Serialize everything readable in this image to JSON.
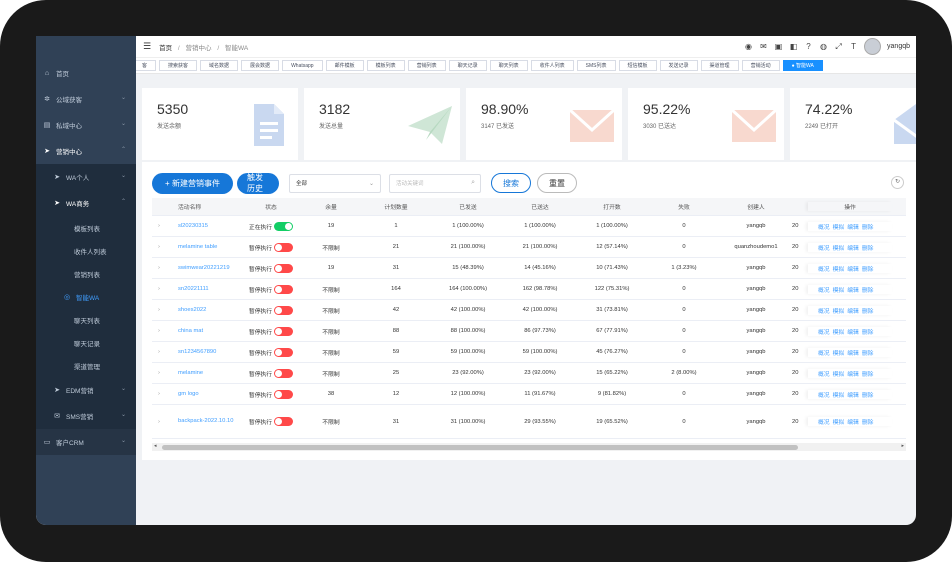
{
  "breadcrumb": [
    "首页",
    "营销中心",
    "智能WA"
  ],
  "user": {
    "name": "yangqb"
  },
  "topbar_icons": [
    "whatsapp-icon",
    "mail-icon",
    "message-icon",
    "chat-icon",
    "help-icon",
    "globe-icon",
    "fullscreen-icon",
    "font-size-icon"
  ],
  "sidebar": {
    "items": [
      {
        "label": "首页",
        "icon": "home-icon"
      },
      {
        "label": "公域获客",
        "icon": "gear-icon"
      },
      {
        "label": "私域中心",
        "icon": "grid-icon"
      },
      {
        "label": "营销中心",
        "icon": "send-icon"
      }
    ],
    "sub_items": [
      {
        "label": "WA个人",
        "icon": "send-icon"
      },
      {
        "label": "WA商务",
        "icon": "send-icon"
      }
    ],
    "wa_business_items": [
      "模板列表",
      "收件人列表",
      "营销列表",
      "智能WA",
      "聊天列表",
      "聊天记录",
      "渠道管理"
    ],
    "after_items": [
      {
        "label": "EDM营销",
        "icon": "send-icon"
      },
      {
        "label": "SMS营销",
        "icon": "chat-icon"
      }
    ],
    "bottom_item": {
      "label": "客户CRM",
      "icon": "monitor-icon"
    }
  },
  "tabs": [
    "客",
    "搜索获客",
    "域名数据",
    "展会数据",
    "Whatsapp",
    "邮件模板",
    "模板列表",
    "营销列表",
    "聊天记录",
    "聊天列表",
    "收件人列表",
    "SMS列表",
    "短信模板",
    "发送记录",
    "渠道管理",
    "营销活动",
    "智能WA"
  ],
  "stats": [
    {
      "value": "5350",
      "label": "发送余额"
    },
    {
      "value": "3182",
      "label": "发送总量"
    },
    {
      "value": "98.90%",
      "label": "3147 已发送"
    },
    {
      "value": "95.22%",
      "label": "3030 已送达"
    },
    {
      "value": "74.22%",
      "label": "2249 已打开"
    }
  ],
  "toolbar": {
    "new_event": "+ 新建营销事件",
    "history": "触发历史",
    "select_value": "全部",
    "search_placeholder": "活动关键词",
    "search": "搜索",
    "reset": "重置"
  },
  "table": {
    "headers": [
      "活动名称",
      "状态",
      "余量",
      "计划数量",
      "已发送",
      "已送达",
      "打开数",
      "失败",
      "创建人",
      "",
      "操作"
    ],
    "ops": [
      "概况",
      "模拟",
      "编辑",
      "删除"
    ],
    "rows": [
      {
        "name": "sl20230315",
        "status": "正在执行",
        "on": true,
        "left": "19",
        "plan": "1",
        "sent": "1 (100.00%)",
        "delivered": "1 (100.00%)",
        "opened": "1 (100.00%)",
        "failed": "0",
        "creator": "yangqb",
        "time": "20"
      },
      {
        "name": "melamine table",
        "status": "暂停执行",
        "on": false,
        "left": "不限制",
        "plan": "21",
        "sent": "21 (100.00%)",
        "delivered": "21 (100.00%)",
        "opened": "12 (57.14%)",
        "failed": "0",
        "creator": "quanzhoudemo1",
        "time": "20"
      },
      {
        "name": "swimwear20221219",
        "status": "暂停执行",
        "on": false,
        "left": "19",
        "plan": "31",
        "sent": "15 (48.39%)",
        "delivered": "14 (45.16%)",
        "opened": "10 (71.43%)",
        "failed": "1 (3.23%)",
        "creator": "yangqb",
        "time": "20"
      },
      {
        "name": "sn20221111",
        "status": "暂停执行",
        "on": false,
        "left": "不限制",
        "plan": "164",
        "sent": "164 (100.00%)",
        "delivered": "162 (98.78%)",
        "opened": "122 (75.31%)",
        "failed": "0",
        "creator": "yangqb",
        "time": "20"
      },
      {
        "name": "shoes2022",
        "status": "暂停执行",
        "on": false,
        "left": "不限制",
        "plan": "42",
        "sent": "42 (100.00%)",
        "delivered": "42 (100.00%)",
        "opened": "31 (73.81%)",
        "failed": "0",
        "creator": "yangqb",
        "time": "20"
      },
      {
        "name": "china mat",
        "status": "暂停执行",
        "on": false,
        "left": "不限制",
        "plan": "88",
        "sent": "88 (100.00%)",
        "delivered": "86 (97.73%)",
        "opened": "67 (77.91%)",
        "failed": "0",
        "creator": "yangqb",
        "time": "20"
      },
      {
        "name": "sn1234567890",
        "status": "暂停执行",
        "on": false,
        "left": "不限制",
        "plan": "59",
        "sent": "59 (100.00%)",
        "delivered": "59 (100.00%)",
        "opened": "45 (76.27%)",
        "failed": "0",
        "creator": "yangqb",
        "time": "20"
      },
      {
        "name": "melamine",
        "status": "暂停执行",
        "on": false,
        "left": "不限制",
        "plan": "25",
        "sent": "23 (92.00%)",
        "delivered": "23 (92.00%)",
        "opened": "15 (65.22%)",
        "failed": "2 (8.00%)",
        "creator": "yangqb",
        "time": "20"
      },
      {
        "name": "gm logo",
        "status": "暂停执行",
        "on": false,
        "left": "38",
        "plan": "12",
        "sent": "12 (100.00%)",
        "delivered": "11 (91.67%)",
        "opened": "9 (81.82%)",
        "failed": "0",
        "creator": "yangqb",
        "time": "20"
      },
      {
        "name": "backpack-2022.10.10",
        "status": "暂停执行",
        "on": false,
        "left": "不限制",
        "plan": "31",
        "sent": "31 (100.00%)",
        "delivered": "29 (93.55%)",
        "opened": "19 (65.52%)",
        "failed": "0",
        "creator": "yangqb",
        "time": "20"
      }
    ]
  },
  "colors": {
    "primary": "#1677d8",
    "sidebar": "#304156",
    "switch_on": "#13ce66",
    "switch_off": "#ff4949",
    "link": "#409eff"
  }
}
